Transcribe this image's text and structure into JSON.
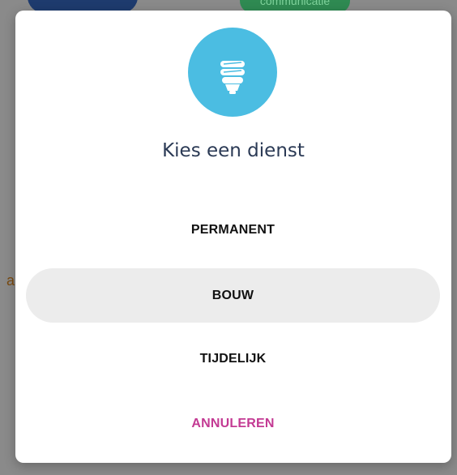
{
  "background": {
    "green_pill_text": "communicatie",
    "fragment_text": "a."
  },
  "dialog": {
    "icon": "lightbulb-icon",
    "icon_circle_color": "#4bbde2",
    "title": "Kies een dienst",
    "options": [
      {
        "label": "PERMANENT",
        "selected": false
      },
      {
        "label": "BOUW",
        "selected": true
      },
      {
        "label": "TIJDELIJK",
        "selected": false
      }
    ],
    "cancel_label": "ANNULEREN",
    "cancel_color": "#c33a93"
  }
}
